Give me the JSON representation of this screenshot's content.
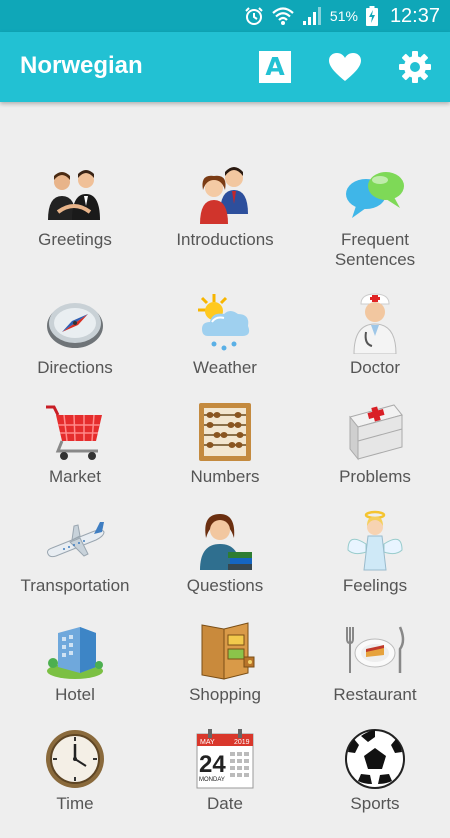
{
  "status_bar": {
    "battery": "51%",
    "time": "12:37"
  },
  "app_bar": {
    "title": "Norwegian",
    "font_icon_letter": "A",
    "accent_color": "#22c1d3",
    "status_color": "#0fa7b8"
  },
  "calendar_icon": {
    "month": "MAY",
    "year": "2019",
    "day": "24",
    "weekday": "MONDAY"
  },
  "categories": [
    {
      "label": "Greetings"
    },
    {
      "label": "Introductions"
    },
    {
      "label": "Frequent\nSentences"
    },
    {
      "label": "Directions"
    },
    {
      "label": "Weather"
    },
    {
      "label": "Doctor"
    },
    {
      "label": "Market"
    },
    {
      "label": "Numbers"
    },
    {
      "label": "Problems"
    },
    {
      "label": "Transportation"
    },
    {
      "label": "Questions"
    },
    {
      "label": "Feelings"
    },
    {
      "label": "Hotel"
    },
    {
      "label": "Shopping"
    },
    {
      "label": "Restaurant"
    },
    {
      "label": "Time"
    },
    {
      "label": "Date"
    },
    {
      "label": "Sports"
    }
  ]
}
